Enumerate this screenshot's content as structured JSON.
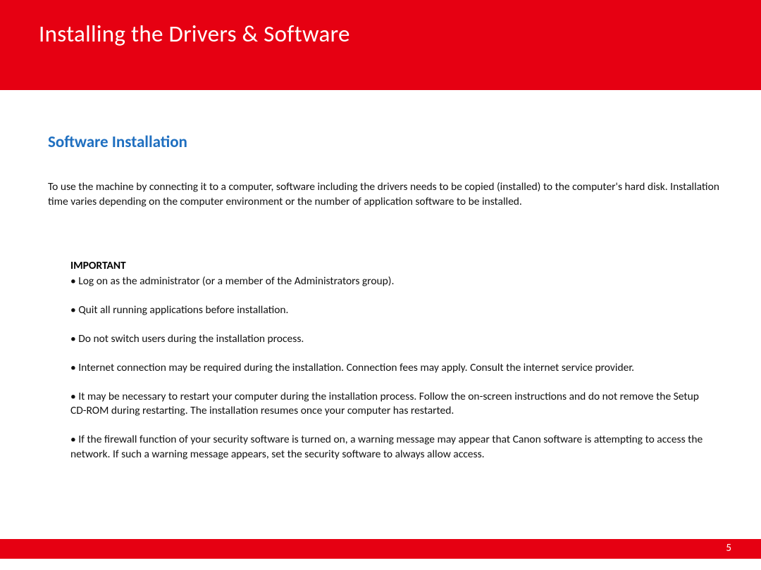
{
  "header": {
    "title": "Installing  the Drivers & Software"
  },
  "section": {
    "heading": "Software Installation",
    "intro": "To use the machine by connecting it to a computer, software including the drivers needs to be copied (installed) to the computer's hard disk. Installation time varies depending on the computer environment or the number of application software to be installed."
  },
  "important": {
    "label": "IMPORTANT",
    "items": [
      "• Log on as the administrator (or a member of the Administrators group).",
      "• Quit all running applications before installation.",
      "• Do not switch users during the installation process.",
      "• Internet connection may be required during the installation. Connection fees may apply. Consult the internet service provider.",
      "• It may be necessary to restart your computer during the installation process. Follow the on-screen instructions and do not remove the Setup CD-ROM during restarting. The installation resumes once your computer has restarted.",
      "• If the firewall function of your security software is turned on, a warning message may appear that Canon software is attempting to access the network. If such a warning message appears, set the security software to always allow access."
    ]
  },
  "footer": {
    "page_number": "5"
  }
}
